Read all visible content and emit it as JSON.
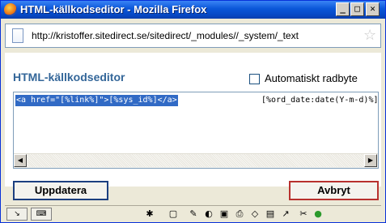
{
  "window": {
    "title": "HTML-källkodseditor - Mozilla Firefox",
    "minimize_label": "_",
    "maximize_label": "□",
    "close_label": "✕"
  },
  "urlbar": {
    "url": "http://kristoffer.sitedirect.se/sitedirect/_modules//_system/_text"
  },
  "editor": {
    "heading": "HTML-källkodseditor",
    "wrap_checkbox_label": "Automatiskt radbyte",
    "wrap_checked": false,
    "code_selected": "<a href=\"[%link%]\">[%sys_id%]</a>",
    "code_rest": "[%ord_date:date(Y-m-d)%]"
  },
  "buttons": {
    "update_label": "Uppdatera",
    "cancel_label": "Avbryt"
  },
  "colors": {
    "titlebar": "#0a56d8",
    "heading": "#336699",
    "selection": "#316ac5",
    "update_border": "#1c3f80",
    "cancel_border": "#b8312f"
  },
  "statusbar_icons": [
    "cursor-icon",
    "keyboard-icon",
    "bug-icon",
    "page-icon",
    "pencil-icon",
    "palette-icon",
    "save-icon",
    "print-icon",
    "paint-icon",
    "window-icon",
    "chart-icon",
    "tools-icon",
    "status-ok-icon"
  ]
}
